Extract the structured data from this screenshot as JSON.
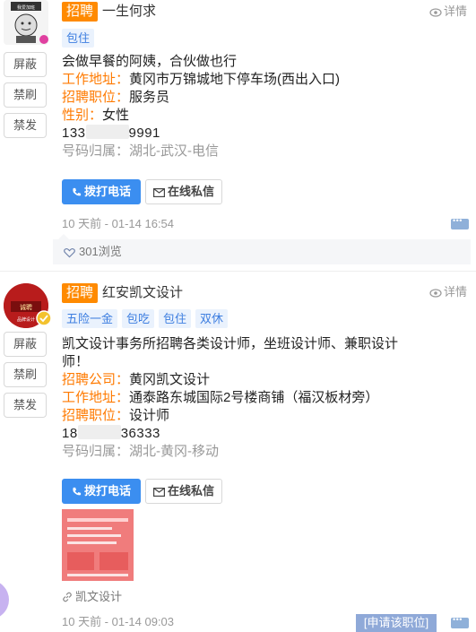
{
  "common": {
    "hire_tag": "招聘",
    "detail_label": "详情",
    "block_label": "屏蔽",
    "ban_label": "禁刷",
    "ban_post_label": "禁发",
    "call_label": "拨打电话",
    "message_label": "在线私信"
  },
  "post1": {
    "avatar_text": "我爱加班·加班使我快乐",
    "author": "一生何求",
    "chips": [
      "包住"
    ],
    "desc": "会做早餐的阿姨，合伙做也行",
    "fields": [
      {
        "key": "工作地址：",
        "value": "黄冈市万锦城地下停车场(西出入口)"
      },
      {
        "key": "招聘职位：",
        "value": "服务员"
      },
      {
        "key": "性别：",
        "value": "女性"
      }
    ],
    "phone_prefix": "133",
    "phone_suffix": "9991",
    "phone_location": "号码归属：湖北-武汉-电信",
    "time": "10 天前 - 01-14 16:54",
    "views": "301浏览"
  },
  "post2": {
    "avatar_text": "诚聘品牌设计",
    "author": "红安凯文设计",
    "chips": [
      "五险一金",
      "包吃",
      "包住",
      "双休"
    ],
    "desc_line1": "凯文设计事务所招聘各类设计师，坐班设计师、兼职设计",
    "desc_line2": "师！",
    "fields": [
      {
        "key": "招聘公司：",
        "value": "黄冈凯文设计"
      },
      {
        "key": "工作地址：",
        "value": "通泰路东城国际2号楼商铺（福汉板材旁）"
      },
      {
        "key": "招聘职位：",
        "value": "设计师"
      }
    ],
    "phone_prefix": "18",
    "phone_suffix": "36333",
    "phone_location": "号码归属：湖北-黄冈-移动",
    "link_text": "凯文设计",
    "time": "10 天前 - 01-14 09:03",
    "apply_label": "[申请该职位]"
  },
  "colors": {
    "hire_tag": "#ff8a00",
    "field_key": "#ff7a00",
    "call_button": "#3b8ef0",
    "chip_text": "#3d7ee0"
  }
}
